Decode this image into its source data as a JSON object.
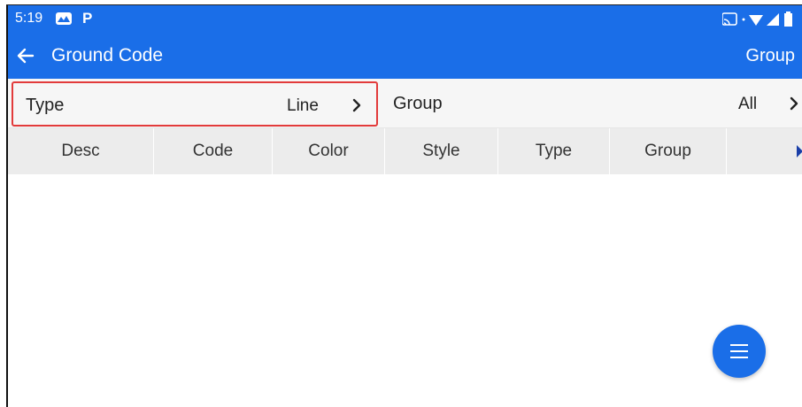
{
  "status_bar": {
    "time": "5:19",
    "icons": [
      "gallery-icon",
      "parking-p-icon",
      "cast-icon",
      "wifi-icon",
      "signal-icon",
      "battery-icon"
    ],
    "p_glyph": "P"
  },
  "app_bar": {
    "title": "Ground Code",
    "action_label": "Group",
    "color": "#1a6ee8"
  },
  "filters": {
    "type_label": "Type",
    "type_value": "Line",
    "group_label": "Group",
    "group_value": "All",
    "highlight_color": "#e23b3b"
  },
  "table": {
    "columns": [
      "Desc",
      "Code",
      "Color",
      "Style",
      "Type",
      "Group"
    ],
    "rows": []
  },
  "fab": {
    "icon": "menu-icon"
  }
}
